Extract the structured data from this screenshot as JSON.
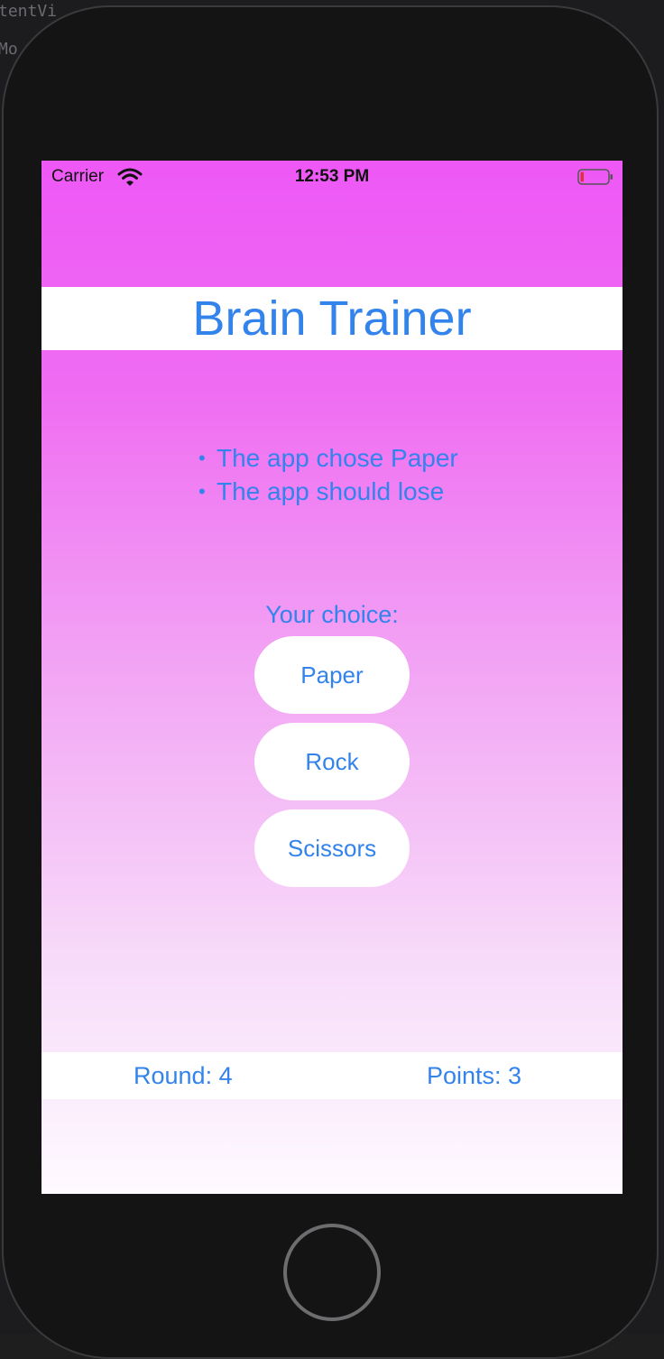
{
  "ide": {
    "fragment_top": "tentVi",
    "fragment_side": "Mo"
  },
  "status_bar": {
    "carrier": "Carrier",
    "time": "12:53 PM",
    "wifi_icon": "wifi-icon",
    "battery_icon": "battery-low-icon"
  },
  "app": {
    "title": "Brain Trainer",
    "info": [
      "The app chose Paper",
      "The app should lose"
    ],
    "choice_label": "Your choice:",
    "choices": [
      "Paper",
      "Rock",
      "Scissors"
    ],
    "round_label": "Round: 4",
    "points_label": "Points: 3"
  },
  "colors": {
    "accent": "#3383ec",
    "gradient_top": "#ee58f6",
    "gradient_bottom": "#fefaff",
    "battery_low": "#e0323a"
  }
}
